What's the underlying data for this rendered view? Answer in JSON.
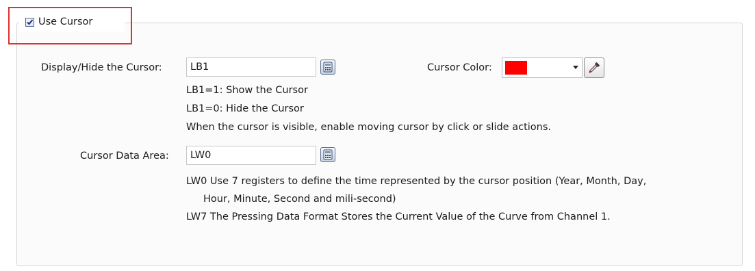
{
  "use_cursor": {
    "label": "Use Cursor",
    "checked": true
  },
  "display_hide": {
    "label": "Display/Hide the Cursor:",
    "value": "LB1",
    "descriptions": [
      "LB1=1: Show the Cursor",
      "LB1=0: Hide the Cursor",
      "When the cursor is visible, enable moving cursor by click or slide actions."
    ]
  },
  "cursor_color": {
    "label": "Cursor Color:",
    "value": "#ff0000"
  },
  "data_area": {
    "label": "Cursor Data Area:",
    "value": "LW0",
    "descriptions": [
      "LW0 Use 7 registers to define the time represented by the cursor position (Year, Month, Day,",
      "Hour, Minute, Second and mili-second)",
      "LW7 The Pressing Data Format Stores the Current Value of the Curve from Channel 1."
    ]
  },
  "icons": {
    "calculator": "calculator-icon",
    "dropper": "eyedropper-icon",
    "check": "checkmark-icon"
  },
  "colors": {
    "highlight": "#e03030",
    "swatch": "#ff0000"
  }
}
